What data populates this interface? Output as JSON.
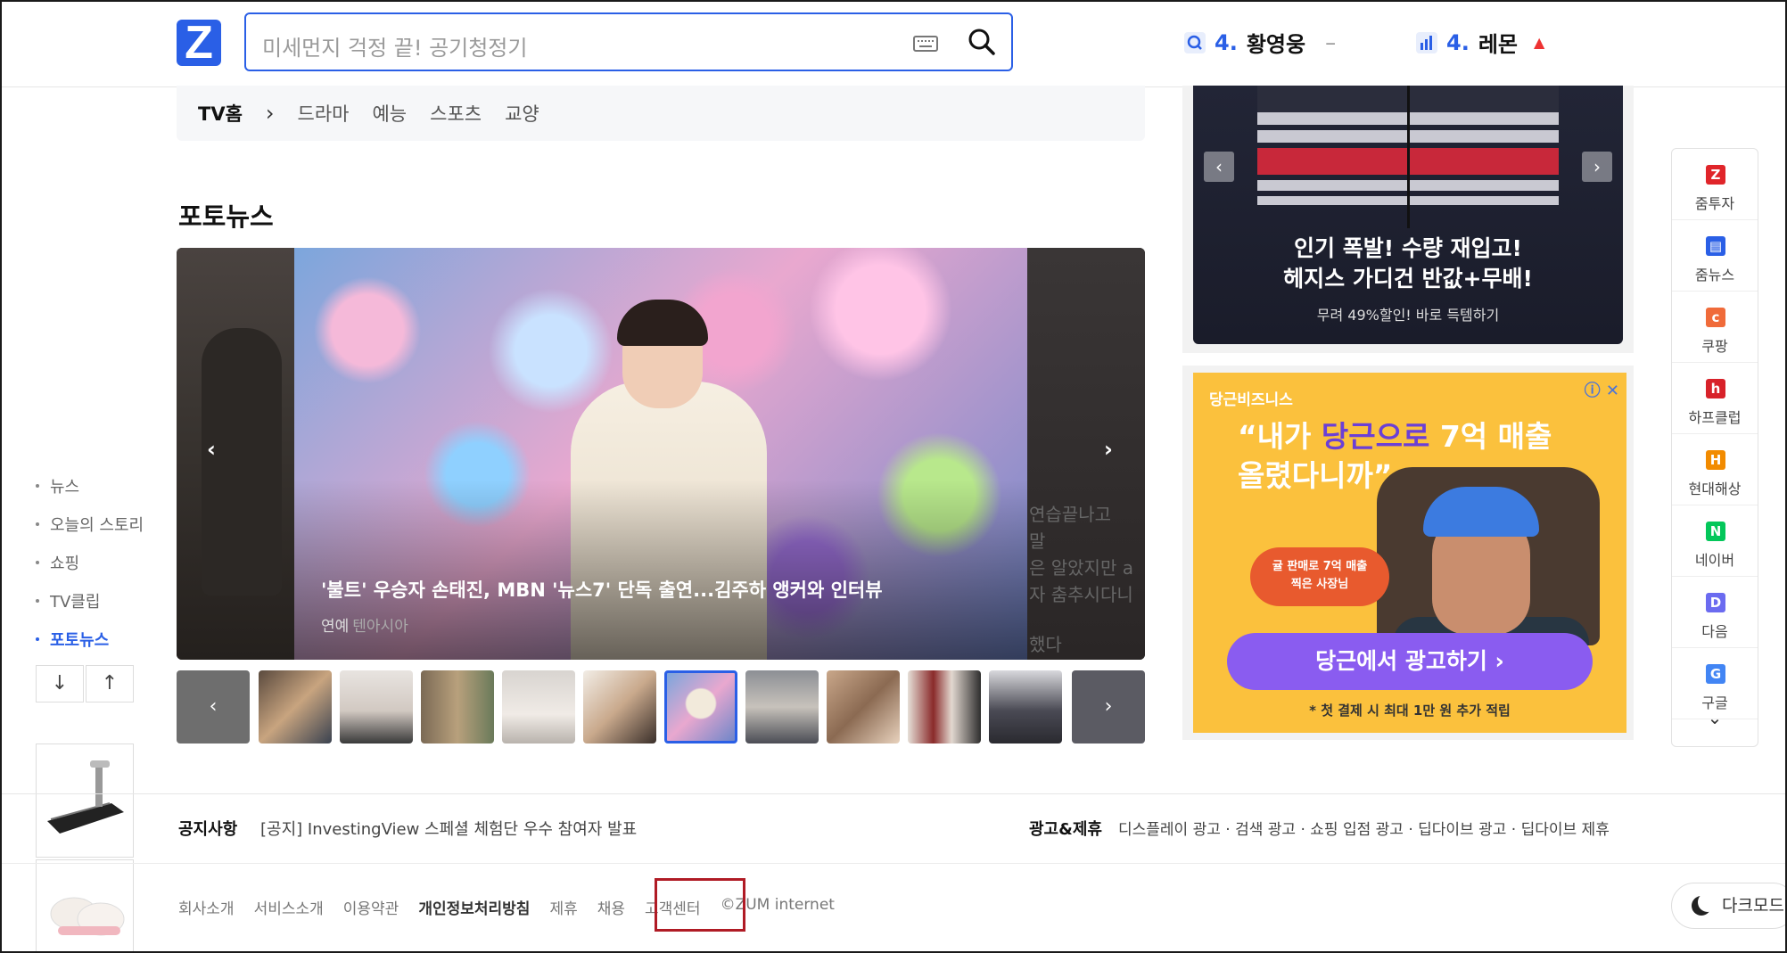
{
  "header": {
    "logo": "Z",
    "search_placeholder": "미세먼지 걱정 끝! 공기청정기",
    "rank1": {
      "num": "4.",
      "word": "황영웅",
      "change": "–"
    },
    "rank2": {
      "num": "4.",
      "word": "레몬",
      "change": "▲"
    }
  },
  "tvnav": {
    "home": "TV홈",
    "sep": "›",
    "items": [
      "드라마",
      "예능",
      "스포츠",
      "교양"
    ]
  },
  "photo_news": {
    "title": "포토뉴스",
    "caption": "'불트' 우승자 손태진, MBN '뉴스7' 단독 출연...김주하 앵커와 인터뷰",
    "category": "연예",
    "source": "텐아시아",
    "right_peek_lines": [
      "연습끝나고",
      "말",
      "은 알았지만 a",
      "자 춤추시다니",
      "했다"
    ],
    "prev": "‹",
    "next": "›"
  },
  "left_nav": {
    "items": [
      "뉴스",
      "오늘의 스토리",
      "쇼핑",
      "TV클립",
      "포토뉴스"
    ],
    "active": "포토뉴스",
    "down": "↓",
    "top": "↑"
  },
  "ad1": {
    "title_line1": "인기 폭발! 수량 재입고!",
    "title_line2": "헤지스 가디건 반값+무배!",
    "sub": "무려 49%할인! 바로 득템하기",
    "prev": "‹",
    "next": "›"
  },
  "ad2": {
    "brand": "당근비즈니스",
    "close": "ⓘ ✕",
    "quote_line1_a": "“내가 ",
    "quote_line1_hl": "당근으로",
    "quote_line1_b": " 7억 매출",
    "quote_line2": "올렸다니까”",
    "pill": "귤 판매로 7억 매출\n찍은 사장님",
    "button": "당근에서 광고하기 ›",
    "note": "* 첫 결제 시 최대 1만 원 추가 적립"
  },
  "rail": {
    "items": [
      {
        "label": "줌투자",
        "glyph": "Z",
        "color": "#e0252a"
      },
      {
        "label": "줌뉴스",
        "glyph": "▤",
        "color": "#2a5fe6"
      },
      {
        "label": "쿠팡",
        "glyph": "c",
        "color": "#f06b3a"
      },
      {
        "label": "하프클럽",
        "glyph": "h",
        "color": "#d8222a"
      },
      {
        "label": "현대해상",
        "glyph": "H",
        "color": "#f28b00"
      },
      {
        "label": "네이버",
        "glyph": "N",
        "color": "#03c75a"
      },
      {
        "label": "다음",
        "glyph": "D",
        "color": "#6b6bf0"
      },
      {
        "label": "구글",
        "glyph": "G",
        "color": "#4285f4"
      }
    ],
    "more": "⌄"
  },
  "footer": {
    "notice_label": "공지사항",
    "notice_text": "[공지] InvestingView 스페셜 체험단 우수 참여자 발표",
    "ad_label": "광고&제휴",
    "ad_links": "디스플레이 광고 · 검색 광고 · 쇼핑 입점 광고 · 딥다이브 광고 · 딥다이브 제휴",
    "links": [
      "회사소개",
      "서비스소개",
      "이용약관",
      "개인정보처리방침",
      "제휴",
      "채용",
      "고객센터",
      "©ZUM internet"
    ],
    "darkmode": "다크모드"
  }
}
